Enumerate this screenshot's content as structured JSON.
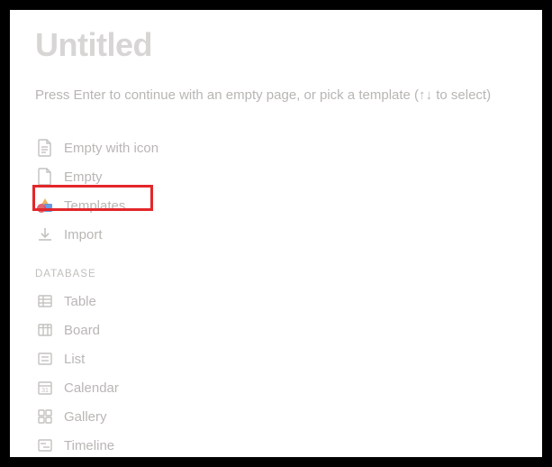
{
  "page": {
    "title": "Untitled",
    "hint": "Press Enter to continue with an empty page, or pick a template (↑↓ to select)"
  },
  "options": {
    "empty_icon": "Empty with icon",
    "empty": "Empty",
    "templates": "Templates",
    "import": "Import"
  },
  "section": {
    "database_label": "DATABASE"
  },
  "database": {
    "table": "Table",
    "board": "Board",
    "list": "List",
    "calendar": "Calendar",
    "gallery": "Gallery",
    "timeline": "Timeline"
  },
  "highlight": {
    "target": "templates"
  }
}
